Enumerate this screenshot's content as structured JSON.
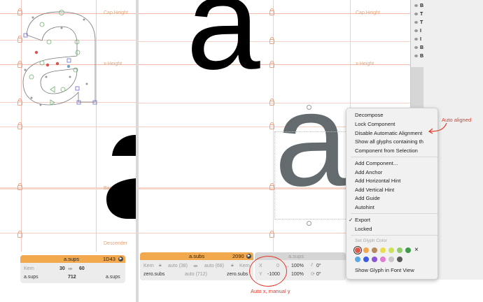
{
  "left_panel": {
    "metrics": {
      "cap_height": "Cap Height",
      "x_height": "x-Height",
      "baseline": "Baseline",
      "descender": "Descender"
    },
    "info": {
      "glyph_name": "a.sups",
      "unicode": "1D43",
      "kern_label": "Kern",
      "lsb": "30",
      "rsb": "60",
      "left_group": "a.sups",
      "width": "712",
      "right_group": "a.sups"
    }
  },
  "main_panel": {
    "metrics": {
      "cap_height": "Cap Height",
      "x_height": "x-Height"
    },
    "glyph_char": "a",
    "info": {
      "glyph_name": "a.subs",
      "width_value": "2090",
      "kern_label": "Kern",
      "lsb": "auto (38)",
      "rsb": "auto (68)",
      "kern_right": "Kern",
      "left_group": "zero.subs",
      "width": "auto (712)",
      "right_group": "zero.subs"
    },
    "component": {
      "name": "a.sups",
      "x_label": "X",
      "x_value": "0",
      "y_label": "Y",
      "y_value": "-1000",
      "scale_x": "100%",
      "scale_y": "100%",
      "rotation": "0°",
      "slant": "0°"
    }
  },
  "sidebar": {
    "items": [
      "B",
      "T",
      "T",
      "I",
      "I",
      "B",
      "B"
    ]
  },
  "context_menu": {
    "items_group1": [
      "Decompose",
      "Lock Component",
      "Disable Automatic Alignment",
      "Show all glyphs containing th",
      "Component from Selection"
    ],
    "items_group2": [
      "Add Component...",
      "Add Anchor",
      "Add Horizontal Hint",
      "Add Vertical Hint",
      "Add Guide",
      "Autohint"
    ],
    "export_label": "Export",
    "export_checked": true,
    "locked_label": "Locked",
    "set_glyph_color": "Set Glyph Color",
    "show_in_font_view": "Show Glyph in Font View",
    "check_mark": "✓",
    "clear_color_glyph": "×",
    "colors_row1": [
      "#e2574c",
      "#f2a94e",
      "#b58a5c",
      "#e9df4d",
      "#cbe05c",
      "#8fcf6a",
      "#3e9a4a"
    ],
    "colors_row2": [
      "#5aa8e8",
      "#3d5ce0",
      "#8a54d6",
      "#e27ad3",
      "#c7c7c7",
      "#5a5a5a"
    ]
  },
  "annotations": {
    "auto_aligned": "Auto aligned",
    "auto_x_manual_y": "Auto x, manual y"
  },
  "colors": {
    "accent_orange": "#f2a94e",
    "annotation_red": "#e03a2a",
    "component_gray": "#646b6e"
  }
}
